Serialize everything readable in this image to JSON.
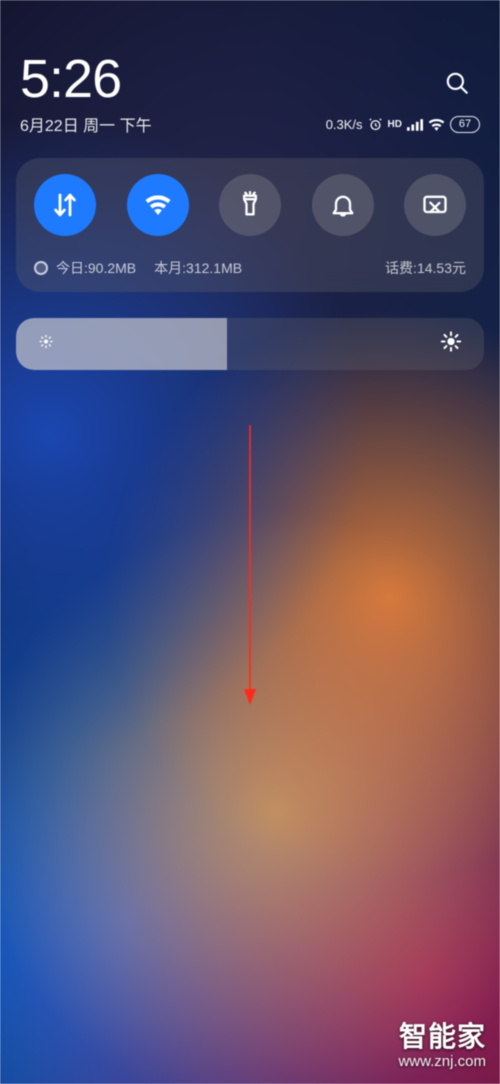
{
  "header": {
    "time": "5:26",
    "date": "6月22日 周一 下午",
    "net_speed": "0.3K/s",
    "hd_label": "HD",
    "battery_level": "67"
  },
  "toggles": {
    "data": {
      "name": "mobile-data",
      "active": true
    },
    "wifi": {
      "name": "wifi",
      "active": true
    },
    "flashlight": {
      "name": "flashlight",
      "active": false
    },
    "bell": {
      "name": "notifications",
      "active": false
    },
    "screenshot": {
      "name": "screenshot",
      "active": false
    }
  },
  "usage": {
    "today_label": "今日:90.2MB",
    "month_label": "本月:312.1MB",
    "balance_label": "话费:14.53元"
  },
  "brightness": {
    "percent": 45
  },
  "watermark": {
    "brand": "智能家",
    "url": "www.znj.com"
  }
}
